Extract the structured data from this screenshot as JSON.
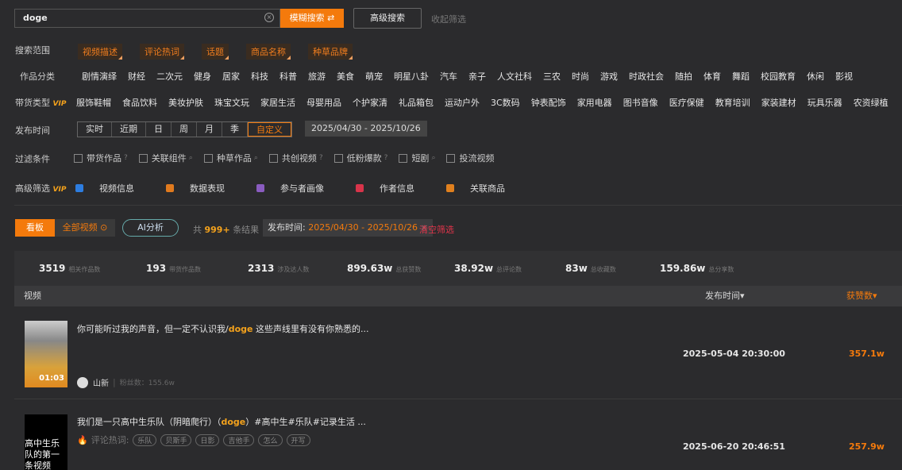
{
  "search": {
    "value": "doge",
    "fuzzy_label": "模糊搜索 ⇄",
    "advanced_label": "高级搜索",
    "collapse_label": "收起筛选"
  },
  "scope": {
    "label": "搜索范围",
    "items": [
      "视频描述",
      "评论热词",
      "话题",
      "商品名称",
      "种草品牌"
    ]
  },
  "category": {
    "label": "作品分类",
    "items": [
      "剧情演绎",
      "财经",
      "二次元",
      "健身",
      "居家",
      "科技",
      "科普",
      "旅游",
      "美食",
      "萌宠",
      "明星八卦",
      "汽车",
      "亲子",
      "人文社科",
      "三农",
      "时尚",
      "游戏",
      "时政社会",
      "随拍",
      "体育",
      "舞蹈",
      "校园教育",
      "休闲",
      "影视"
    ]
  },
  "goods_type": {
    "label": "带货类型",
    "vip": "VIP",
    "items": [
      "服饰鞋帽",
      "食品饮料",
      "美妆护肤",
      "珠宝文玩",
      "家居生活",
      "母婴用品",
      "个护家清",
      "礼品箱包",
      "运动户外",
      "3C数码",
      "钟表配饰",
      "家用电器",
      "图书音像",
      "医疗保健",
      "教育培训",
      "家装建材",
      "玩具乐器",
      "农资绿植"
    ]
  },
  "publish_time": {
    "label": "发布时间",
    "options": [
      "实时",
      "近期",
      "日",
      "周",
      "月",
      "季",
      "自定义"
    ],
    "selected": "自定义",
    "range": "2025/04/30  -  2025/10/26"
  },
  "filters": {
    "label": "过滤条件",
    "items": [
      {
        "label": "带货作品",
        "help": "?"
      },
      {
        "label": "关联组件",
        "help": "⌕"
      },
      {
        "label": "种草作品",
        "help": "⌕"
      },
      {
        "label": "共创视频",
        "help": "?"
      },
      {
        "label": "低粉爆款",
        "help": "?"
      },
      {
        "label": "短剧",
        "help": "⌕"
      },
      {
        "label": "投流视频",
        "help": ""
      }
    ]
  },
  "advanced": {
    "label": "高级筛选",
    "vip": "VIP",
    "items": [
      {
        "label": "视频信息",
        "color": "#2d7de0"
      },
      {
        "label": "数据表现",
        "color": "#e07a1e"
      },
      {
        "label": "参与者画像",
        "color": "#8a5cc0"
      },
      {
        "label": "作者信息",
        "color": "#d8344a"
      },
      {
        "label": "关联商品",
        "color": "#e0801e"
      }
    ]
  },
  "toolbar": {
    "board": "看板",
    "all_videos": "全部视频",
    "ai": "AI分析",
    "total_prefix": "共",
    "total": "999+",
    "total_suffix": "条结果",
    "chip_label": "发布时间:",
    "chip_value": "2025/04/30 - 2025/10/26",
    "clear": "清空筛选"
  },
  "stats": [
    {
      "v": "3519",
      "l": "相关作品数"
    },
    {
      "v": "193",
      "l": "带货作品数"
    },
    {
      "v": "2313",
      "l": "涉及达人数"
    },
    {
      "v": "899.63w",
      "l": "总获赞数"
    },
    {
      "v": "38.92w",
      "l": "总评论数"
    },
    {
      "v": "83w",
      "l": "总收藏数"
    },
    {
      "v": "159.86w",
      "l": "总分享数"
    }
  ],
  "table": {
    "col_video": "视频",
    "col_time": "发布时间▾",
    "col_likes": "获赞数▾"
  },
  "rows": [
    {
      "pre": "你可能听过我的声音，但一定不认识我/",
      "kw": "doge",
      "post": " 这些声线里有没有你熟悉的...",
      "duration": "01:03",
      "author": "山新",
      "fans": "粉丝数：155.6w",
      "time": "2025-05-04 20:30:00",
      "likes": "357.1w"
    },
    {
      "pre": "我们是一只高中生乐队（阴暗爬行）（",
      "kw": "doge",
      "post": "）#高中生#乐队#记录生活 ...",
      "hot_label": "评论热词:",
      "tags": [
        "乐队",
        "贝斯手",
        "日影",
        "吉他手",
        "怎么",
        "开写"
      ],
      "thumb_text": "高中生乐队的第一条视频",
      "time": "2025-06-20 20:46:51",
      "likes": "257.9w"
    }
  ]
}
